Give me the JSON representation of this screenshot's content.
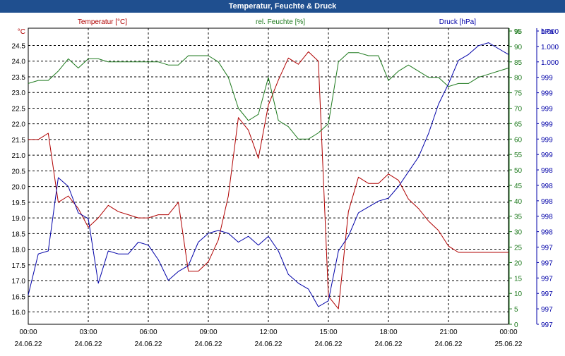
{
  "window": {
    "title": "Temperatur, Feuchte & Druck"
  },
  "chart_data": {
    "type": "line",
    "title": "Temperatur, Feuchte & Druck",
    "colors": {
      "temperature": "#b00000",
      "humidity": "#1e7a1e",
      "pressure": "#0000a8",
      "grid": "#000000"
    },
    "axes": {
      "temperature": {
        "unit": "°C",
        "ticks": [
          "24.5",
          "24.0",
          "23.5",
          "23.0",
          "22.5",
          "22.0",
          "21.5",
          "21.0",
          "20.5",
          "20.0",
          "19.5",
          "19.0",
          "18.5",
          "18.0",
          "17.5",
          "17.0",
          "16.5",
          "16.0"
        ],
        "ylim": [
          15.8,
          24.9
        ]
      },
      "humidity": {
        "unit": "%",
        "ticks": [
          "95",
          "90",
          "85",
          "80",
          "75",
          "70",
          "65",
          "60",
          "55",
          "50",
          "45",
          "40",
          "35",
          "30",
          "25",
          "20",
          "15",
          "10",
          "5",
          "0"
        ],
        "ylim": [
          0,
          95
        ]
      },
      "pressure": {
        "unit": "hPa",
        "ticks": [
          "1.000",
          "1.000",
          "1.000",
          "999",
          "999",
          "999",
          "999",
          "999",
          "999",
          "998",
          "998",
          "998",
          "998",
          "998",
          "997",
          "997",
          "997",
          "997",
          "997",
          "997"
        ]
      }
    },
    "x_ticks": [
      {
        "time": "00:00",
        "date": "24.06.22"
      },
      {
        "time": "03:00",
        "date": "24.06.22"
      },
      {
        "time": "06:00",
        "date": "24.06.22"
      },
      {
        "time": "09:00",
        "date": "24.06.22"
      },
      {
        "time": "12:00",
        "date": "24.06.22"
      },
      {
        "time": "15:00",
        "date": "24.06.22"
      },
      {
        "time": "18:00",
        "date": "24.06.22"
      },
      {
        "time": "21:00",
        "date": "24.06.22"
      },
      {
        "time": "00:00",
        "date": "25.06.22"
      }
    ],
    "x_hours": [
      0,
      0.5,
      1,
      1.5,
      2,
      2.5,
      3,
      3.5,
      4,
      4.5,
      5,
      5.5,
      6,
      6.5,
      7,
      7.5,
      8,
      8.5,
      9,
      9.5,
      10,
      10.5,
      11,
      11.5,
      12,
      12.5,
      13,
      13.5,
      14,
      14.5,
      15,
      15.5,
      16,
      16.5,
      17,
      17.5,
      18,
      18.5,
      19,
      19.5,
      20,
      20.5,
      21,
      21.5,
      22,
      22.5,
      23,
      23.5,
      24
    ],
    "series": [
      {
        "name": "Temperatur [°C]",
        "axis": "temperature",
        "values": [
          21.5,
          21.5,
          21.7,
          19.5,
          19.7,
          19.3,
          18.7,
          19.0,
          19.4,
          19.2,
          19.1,
          19.0,
          19.0,
          19.1,
          19.1,
          19.5,
          17.3,
          17.3,
          17.6,
          18.3,
          19.7,
          22.2,
          21.8,
          20.9,
          22.6,
          23.4,
          24.1,
          23.9,
          24.3,
          24.0,
          16.5,
          16.1,
          19.2,
          20.3,
          20.1,
          20.1,
          20.4,
          20.2,
          19.6,
          19.3,
          18.9,
          18.6,
          18.1,
          17.9,
          17.9,
          17.9,
          17.9,
          17.9,
          17.9
        ]
      },
      {
        "name": "rel. Feuchte [%]",
        "axis": "humidity",
        "values": [
          78,
          79,
          79,
          82,
          86,
          83,
          86,
          86,
          85,
          85,
          85,
          85,
          85,
          85,
          84,
          84,
          87,
          87,
          87,
          85,
          80,
          70,
          66,
          68,
          80,
          66,
          64,
          60,
          60,
          62,
          65,
          85,
          88,
          88,
          87,
          87,
          79,
          82,
          84,
          82,
          80,
          80,
          77,
          78,
          78,
          80,
          81,
          82,
          83
        ]
      },
      {
        "name": "Druck [hPa]",
        "axis": "pressure",
        "values": [
          10,
          24,
          25,
          50,
          47,
          38,
          36,
          14,
          25,
          24,
          24,
          28,
          27,
          22,
          15,
          18,
          20,
          28,
          31,
          32,
          31,
          28,
          30,
          27,
          30,
          25,
          17,
          14,
          12,
          6,
          8,
          25,
          30,
          38,
          40,
          42,
          43,
          47,
          52,
          57,
          65,
          75,
          82,
          90,
          92,
          95,
          96,
          94,
          92
        ]
      }
    ]
  }
}
